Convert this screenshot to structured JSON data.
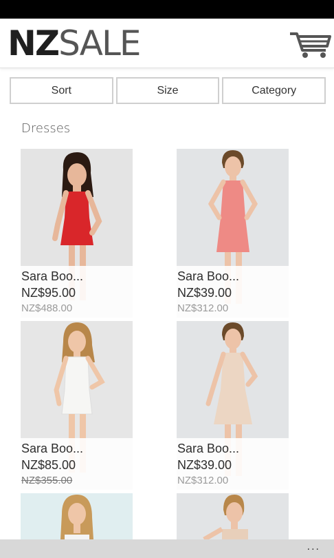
{
  "header": {
    "logo_nz": "NZ",
    "logo_sale": "SALE",
    "cart_icon": "shopping-cart-icon"
  },
  "filters": {
    "sort": "Sort",
    "size": "Size",
    "category": "Category"
  },
  "section_title": "Dresses",
  "products": [
    {
      "name": "Sara Boo...",
      "price": "NZ$95.00",
      "original_price": "NZ$488.00",
      "dress_color": "#d9262a"
    },
    {
      "name": "Sara Boo...",
      "price": "NZ$39.00",
      "original_price": "NZ$312.00",
      "dress_color": "#ee8a85"
    },
    {
      "name": "Sara Boo...",
      "price": "NZ$85.00",
      "original_price": "NZ$355.00",
      "dress_color": "#f6f6f4"
    },
    {
      "name": "Sara Boo...",
      "price": "NZ$39.00",
      "original_price": "NZ$312.00",
      "dress_color": "#ecd6c3"
    }
  ],
  "app_bar": {
    "more_label": "..."
  }
}
